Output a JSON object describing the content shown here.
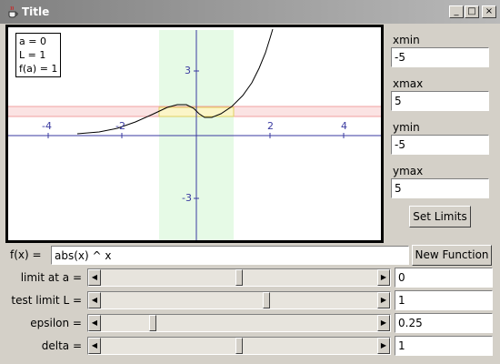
{
  "window": {
    "title": "Title",
    "app_icon": "java-cup-icon",
    "controls": {
      "minimize": "_",
      "maximize": "□",
      "close": "×"
    }
  },
  "plot": {
    "info": {
      "a": "a = 0",
      "L": "L = 1",
      "fa": "f(a) = 1"
    },
    "x_ticks": [
      "-4",
      "-2",
      "2",
      "4"
    ],
    "y_ticks": [
      "3",
      "-3"
    ],
    "colors": {
      "axes": "#3a3aa0",
      "curve": "#000000",
      "delta_band": "#e6fae6",
      "epsilon_band": "#fbe3e3",
      "epsilon_line": "#f0a0a0"
    }
  },
  "limits": {
    "xmin_label": "xmin",
    "xmin": "-5",
    "xmax_label": "xmax",
    "xmax": "5",
    "ymin_label": "ymin",
    "ymin": "-5",
    "ymax_label": "ymax",
    "ymax": "5",
    "set_button": "Set Limits"
  },
  "function": {
    "label": "f(x) =",
    "value": "abs(x) ^ x",
    "new_button": "New Function"
  },
  "sliders": [
    {
      "label": "limit at a =",
      "value": "0",
      "position": 0.5
    },
    {
      "label": "test limit L =",
      "value": "1",
      "position": 0.6
    },
    {
      "label": "epsilon =",
      "value": "0.25",
      "position": 0.18
    },
    {
      "label": "delta =",
      "value": "1",
      "position": 0.5
    }
  ]
}
